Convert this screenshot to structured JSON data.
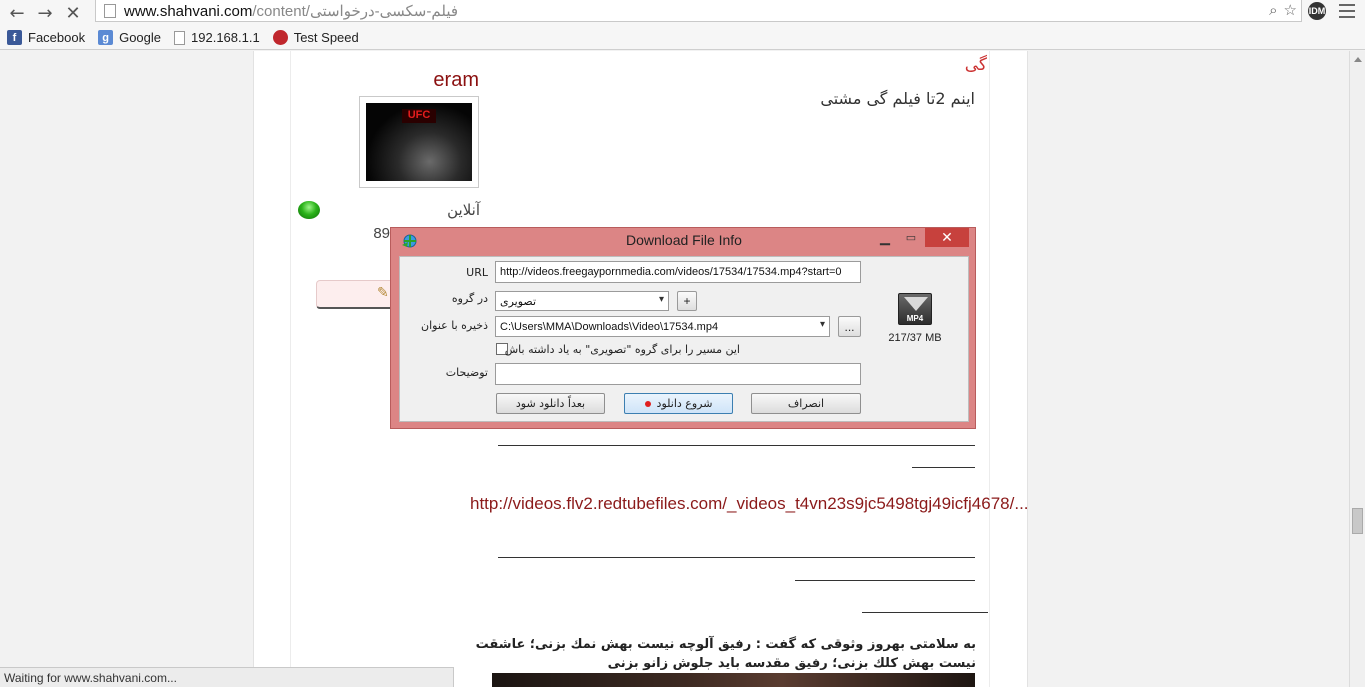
{
  "browser": {
    "url_host": "www.shahvani.com",
    "url_path": "/content/فیلم-سکسی-درخواستی",
    "bookmarks": [
      {
        "label": "Facebook",
        "icon": "facebook-icon"
      },
      {
        "label": "Google",
        "icon": "google-icon"
      },
      {
        "label": "192.168.1.1",
        "icon": "page-icon"
      },
      {
        "label": "Test Speed",
        "icon": "speedtest-icon"
      }
    ],
    "ext_label": "IDM",
    "status": "Waiting for www.shahvani.com..."
  },
  "post": {
    "tag": "گی",
    "username": "eram",
    "text": "اینم 2تا فیلم گی مشتی",
    "avatar_label": "UFC",
    "online": "آنلاین",
    "post_count": "89",
    "link_text": "http://videos.flv2.redtubefiles.com/_videos_t4vn23s9jc5498tgj49icfj4678/...",
    "quote_text": "به سلامتی بهروز وثوقی که گفت : رفیق آلوچه نیست بهش نمك بزنی؛ عاشقت نیست بهش کلك بزنی؛ رفیق مقدسه باید جلوش زانو بزنی"
  },
  "dialog": {
    "title": "Download File Info",
    "url_label": "URL",
    "url_value": "http://videos.freegaypornmedia.com/videos/17534/17534.mp4?start=0",
    "category_label": "در گروه",
    "category_value": "تصویری",
    "add_category_label": "+",
    "save_as_label": "ذخیره با عنوان",
    "save_path": "C:\\Users\\MMA\\Downloads\\Video\\17534.mp4",
    "browse_label": "...",
    "remember_label": "این مسیر را برای گروه \"تصویری\" به یاد داشته باش",
    "remember_checked": false,
    "description_label": "توضیحات",
    "description_value": "",
    "download_later": "بعداً دانلود شود",
    "start_download": "شروع دانلود",
    "cancel": "انصراف",
    "file_type": "MP4",
    "file_size": "217/37  MB"
  }
}
